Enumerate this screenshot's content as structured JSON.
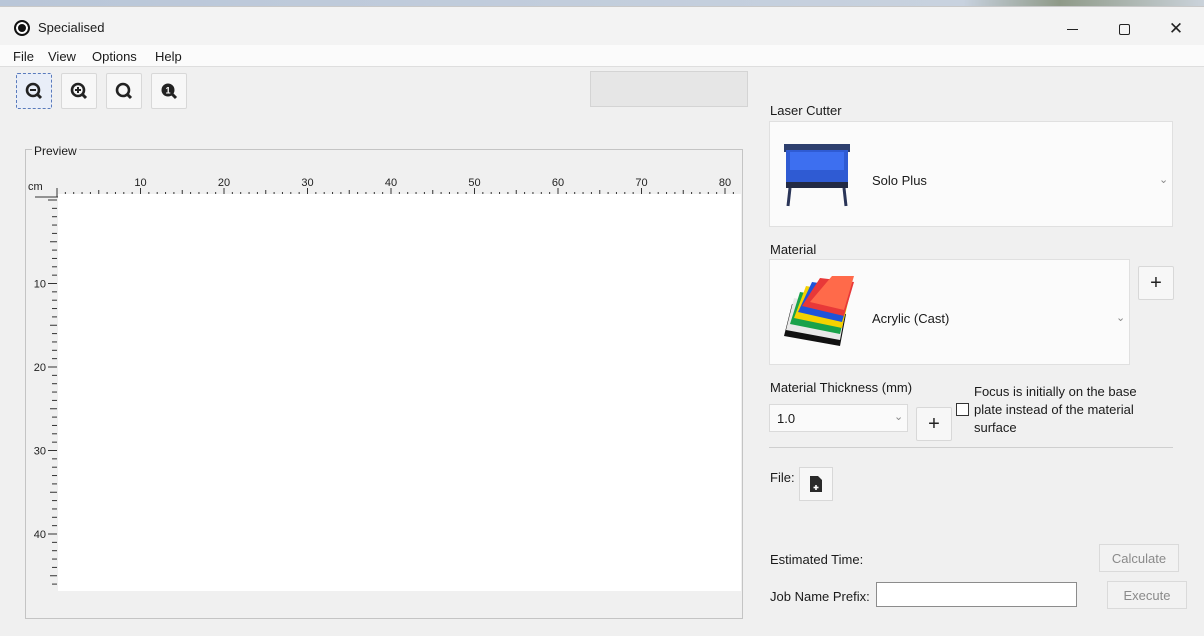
{
  "window": {
    "title": "Specialised",
    "controls": {
      "minimize": "—",
      "maximize": "☐",
      "close": "✕"
    }
  },
  "menu": [
    "File",
    "View",
    "Options",
    "Help"
  ],
  "toolbar": {
    "icons": [
      "zoom-out-icon",
      "zoom-in-icon",
      "zoom-fit-icon",
      "zoom-info-icon"
    ]
  },
  "preview": {
    "label": "Preview",
    "unit": "cm",
    "x_ticks": [
      "10",
      "20",
      "30",
      "40",
      "50",
      "60",
      "70",
      "80"
    ],
    "y_ticks": [
      "10",
      "20",
      "30",
      "40"
    ]
  },
  "laser_cutter": {
    "label": "Laser Cutter",
    "selected": "Solo Plus"
  },
  "material": {
    "label": "Material",
    "selected": "Acrylic (Cast)",
    "add": "+"
  },
  "thickness": {
    "label": "Material Thickness (mm)",
    "selected": "1.0",
    "add": "+"
  },
  "focus_checkbox": {
    "text": "Focus is initially on the base plate instead of the material surface",
    "checked": false
  },
  "file": {
    "label": "File:"
  },
  "estimate": {
    "label": "Estimated Time:",
    "button": "Calculate"
  },
  "job": {
    "label": "Job Name Prefix:",
    "value": "",
    "button": "Execute"
  }
}
